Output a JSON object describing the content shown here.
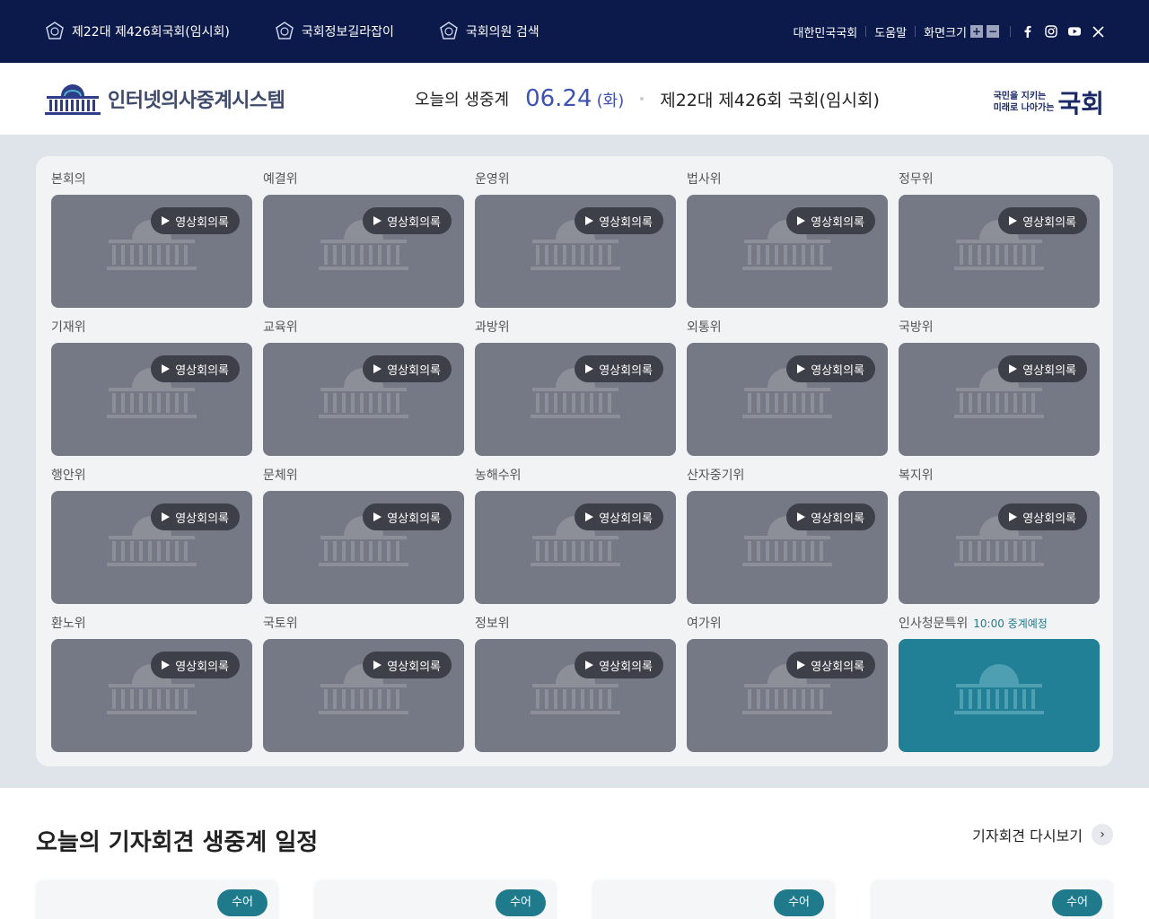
{
  "topbar": {
    "links": [
      {
        "label": "제22대 제426회국회(임시회)",
        "icon": "emblem-icon"
      },
      {
        "label": "국회정보길라잡이",
        "icon": "emblem-icon"
      },
      {
        "label": "국회의원 검색",
        "icon": "emblem-icon"
      }
    ],
    "right": {
      "assembly": "대한민국국회",
      "help": "도움말",
      "fontsize": "화면크기",
      "plus": "+",
      "minus": "−"
    },
    "social": [
      "facebook-icon",
      "instagram-icon",
      "youtube-icon",
      "x-icon"
    ]
  },
  "header": {
    "logo_text": "인터넷의사중계시스템",
    "today_label": "오늘의 생중계",
    "date": "06.24",
    "day": "(화)",
    "session": "제22대 제426회 국회(임시회)",
    "brand_line1": "국민을 지키는",
    "brand_line2": "미래로 나아가는",
    "brand_big": "국회"
  },
  "committees": [
    {
      "name": "본회의",
      "button": "영상회의록"
    },
    {
      "name": "예결위",
      "button": "영상회의록"
    },
    {
      "name": "운영위",
      "button": "영상회의록"
    },
    {
      "name": "법사위",
      "button": "영상회의록"
    },
    {
      "name": "정무위",
      "button": "영상회의록"
    },
    {
      "name": "기재위",
      "button": "영상회의록"
    },
    {
      "name": "교육위",
      "button": "영상회의록"
    },
    {
      "name": "과방위",
      "button": "영상회의록"
    },
    {
      "name": "외통위",
      "button": "영상회의록"
    },
    {
      "name": "국방위",
      "button": "영상회의록"
    },
    {
      "name": "행안위",
      "button": "영상회의록"
    },
    {
      "name": "문체위",
      "button": "영상회의록"
    },
    {
      "name": "농해수위",
      "button": "영상회의록"
    },
    {
      "name": "산자중기위",
      "button": "영상회의록"
    },
    {
      "name": "복지위",
      "button": "영상회의록"
    },
    {
      "name": "환노위",
      "button": "영상회의록"
    },
    {
      "name": "국토위",
      "button": "영상회의록"
    },
    {
      "name": "정보위",
      "button": "영상회의록"
    },
    {
      "name": "여가위",
      "button": "영상회의록"
    },
    {
      "name": "인사청문특위",
      "schedule": "10:00 중계예정"
    }
  ],
  "press": {
    "title": "오늘의 기자회견 생중계 일정",
    "replay": "기자회견 다시보기",
    "cards": [
      {
        "badge": "수어"
      },
      {
        "badge": "수어"
      },
      {
        "badge": "수어"
      },
      {
        "badge": "수어"
      }
    ]
  },
  "colors": {
    "topbar": "#0c1a4b",
    "accent_date": "#3e52b0",
    "live_tile": "#217f96",
    "badge": "#1f7a8c"
  }
}
